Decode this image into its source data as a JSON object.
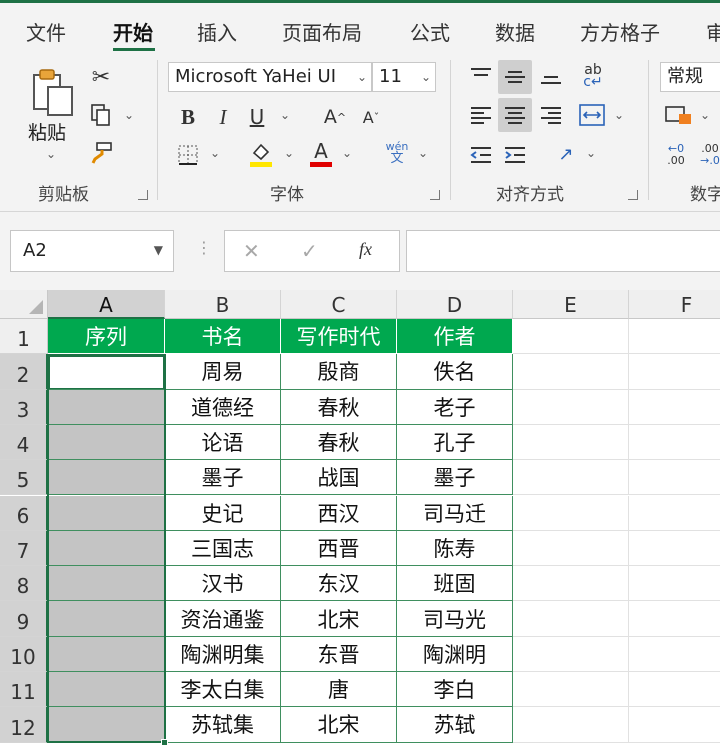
{
  "ribbon_tabs": [
    "文件",
    "开始",
    "插入",
    "页面布局",
    "公式",
    "数据",
    "方方格子",
    "审"
  ],
  "active_tab": "开始",
  "clipboard": {
    "paste_label": "粘贴",
    "group_label": "剪贴板"
  },
  "font": {
    "name": "Microsoft YaHei UI",
    "size": "11",
    "group_label": "字体",
    "phonetic_label": "wén",
    "phonetic_char": "文"
  },
  "alignment": {
    "group_label": "对齐方式",
    "wrap_label": "ab"
  },
  "number": {
    "format": "常规",
    "group_label": "数字"
  },
  "formula_bar": {
    "name_box": "A2",
    "cancel_icon": "✕",
    "enter_icon": "✓",
    "fx_label": "fx",
    "content": ""
  },
  "grid": {
    "columns": [
      "A",
      "B",
      "C",
      "D",
      "E",
      "F"
    ],
    "selected_column": "A",
    "rows": [
      "1",
      "2",
      "3",
      "4",
      "5",
      "6",
      "7",
      "8",
      "9",
      "10",
      "11",
      "12"
    ],
    "headers": [
      "序列",
      "书名",
      "写作时代",
      "作者"
    ],
    "data": [
      [
        "",
        "周易",
        "殷商",
        "佚名"
      ],
      [
        "",
        "道德经",
        "春秋",
        "老子"
      ],
      [
        "",
        "论语",
        "春秋",
        "孔子"
      ],
      [
        "",
        "墨子",
        "战国",
        "墨子"
      ],
      [
        "",
        "史记",
        "西汉",
        "司马迁"
      ],
      [
        "",
        "三国志",
        "西晋",
        "陈寿"
      ],
      [
        "",
        "汉书",
        "东汉",
        "班固"
      ],
      [
        "",
        "资治通鉴",
        "北宋",
        "司马光"
      ],
      [
        "",
        "陶渊明集",
        "东晋",
        "陶渊明"
      ],
      [
        "",
        "李太白集",
        "唐",
        "李白"
      ],
      [
        "",
        "苏轼集",
        "北宋",
        "苏轼"
      ]
    ],
    "selection": "A2:A12"
  },
  "colors": {
    "accent": "#1e7145",
    "header_fill": "#00a84f",
    "selected_fill": "#c4c4c4"
  }
}
